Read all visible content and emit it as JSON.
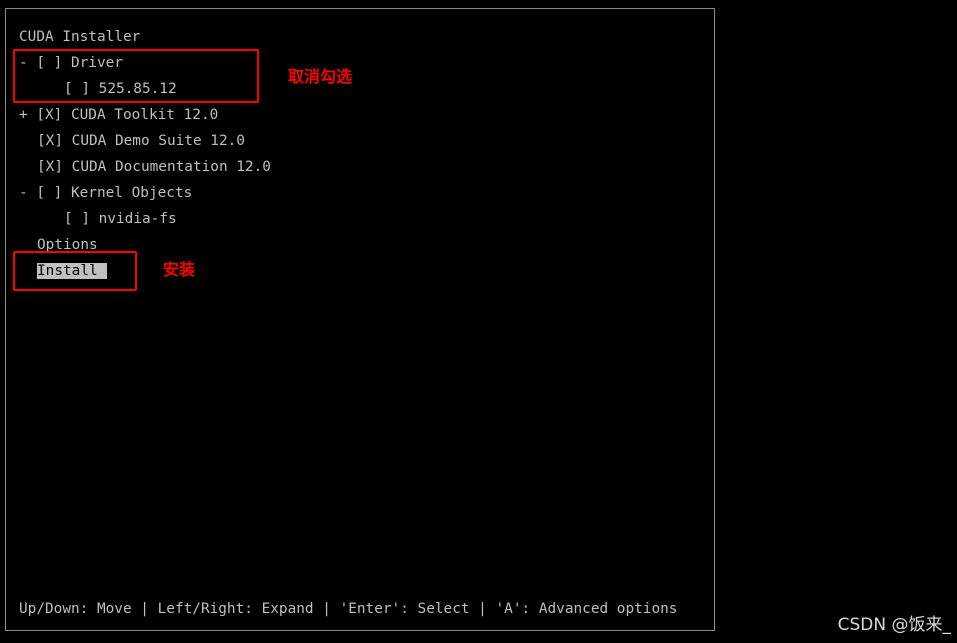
{
  "terminal": {
    "title": "CUDA Installer",
    "items": [
      {
        "prefix": "- [ ] ",
        "label": "Driver"
      },
      {
        "prefix": "[ ] ",
        "label": "525.85.12"
      },
      {
        "prefix": "+ [X] ",
        "label": "CUDA Toolkit 12.0"
      },
      {
        "prefix": "[X] ",
        "label": "CUDA Demo Suite 12.0"
      },
      {
        "prefix": "[X] ",
        "label": "CUDA Documentation 12.0"
      },
      {
        "prefix": "- [ ] ",
        "label": "Kernel Objects"
      },
      {
        "prefix": "[ ] ",
        "label": "nvidia-fs"
      }
    ],
    "options_label": "Options",
    "install_label": "Install",
    "help_text": "Up/Down: Move | Left/Right: Expand | 'Enter': Select | 'A': Advanced options"
  },
  "annotations": {
    "uncheck_note": "取消勾选",
    "install_note": "安装",
    "color": "#ff0000"
  },
  "watermark": "CSDN @饭来_"
}
